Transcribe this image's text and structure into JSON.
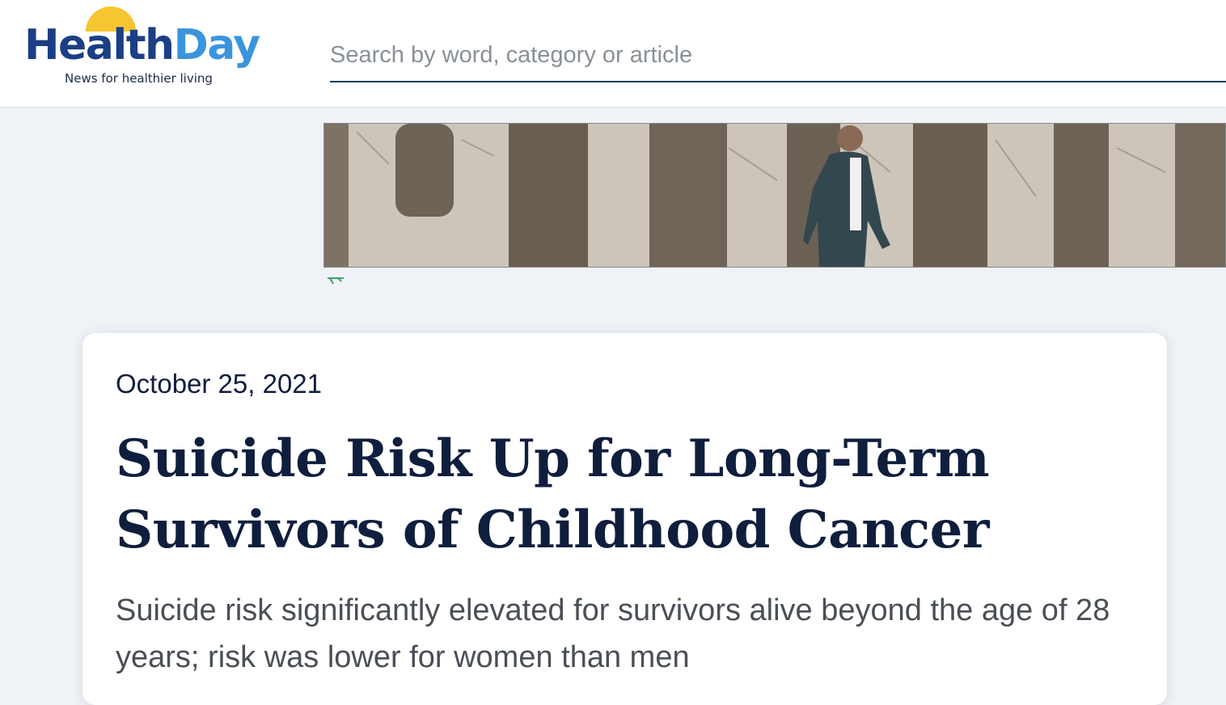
{
  "header": {
    "logo": {
      "word_health": "Health",
      "word_day": "Day",
      "tagline": "News for healthier living",
      "colors": {
        "health": "#1b3e85",
        "day": "#3b95dc",
        "sun": "#f7c531"
      }
    },
    "search": {
      "placeholder": "Search by word, category or article",
      "value": ""
    }
  },
  "ad": {
    "icon": "adchoices-icon"
  },
  "article": {
    "date": "October 25, 2021",
    "title": "Suicide Risk Up for Long-Term Survivors of Childhood Cancer",
    "subtitle": "Suicide risk significantly elevated for survivors alive beyond the age of 28 years; risk was lower for women than men"
  }
}
